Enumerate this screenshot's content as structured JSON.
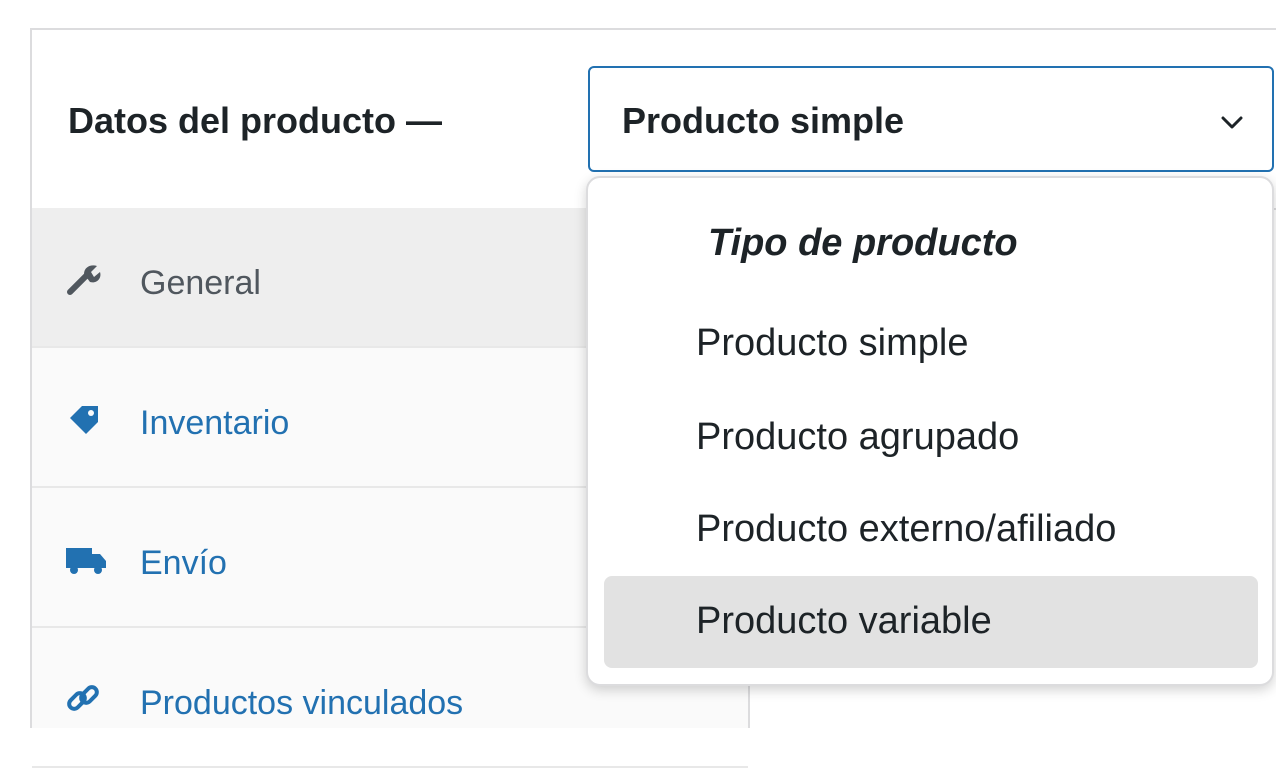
{
  "header": {
    "title": "Datos del producto —",
    "product_type_select": {
      "selected": "Producto simple"
    }
  },
  "tabs": [
    {
      "label": "General",
      "icon": "wrench-icon",
      "active": true
    },
    {
      "label": "Inventario",
      "icon": "tag-icon",
      "active": false
    },
    {
      "label": "Envío",
      "icon": "truck-icon",
      "active": false
    },
    {
      "label": "Productos vinculados",
      "icon": "link-icon",
      "active": false
    }
  ],
  "dropdown": {
    "group_label": "Tipo de producto",
    "options": [
      {
        "label": "Producto simple",
        "highlighted": false
      },
      {
        "label": "Producto agrupado",
        "highlighted": false
      },
      {
        "label": "Producto externo/afiliado",
        "highlighted": false
      },
      {
        "label": "Producto variable",
        "highlighted": true
      }
    ]
  },
  "colors": {
    "accent": "#2271b1",
    "text": "#1d2327",
    "muted_text": "#50575e",
    "highlight": "#e2e2e2",
    "border": "#dcdcde"
  }
}
